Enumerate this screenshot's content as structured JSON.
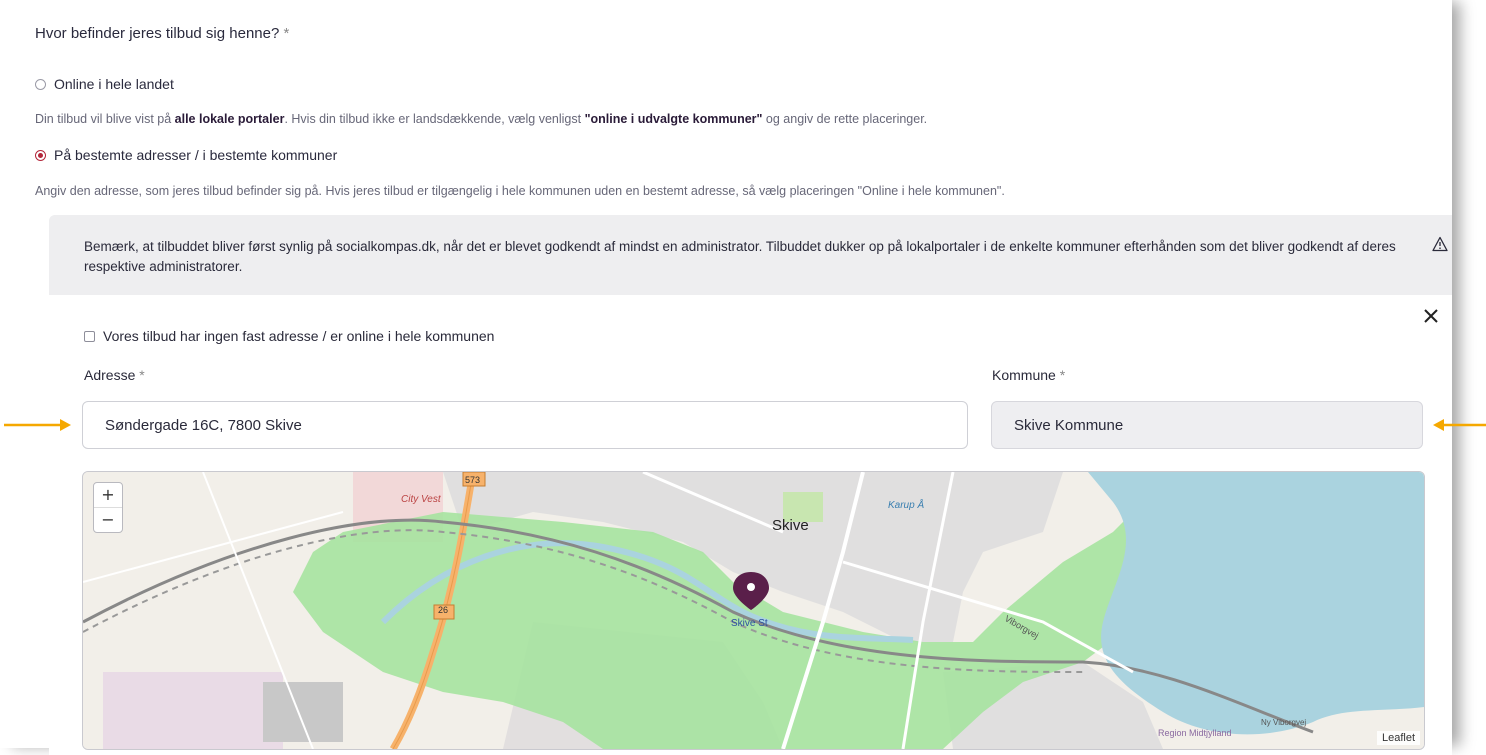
{
  "question": {
    "text": "Hvor befinder jeres tilbud sig henne?",
    "required": "*"
  },
  "options": [
    {
      "label": "Online i hele landet",
      "checked": false,
      "help_parts": [
        "Din tilbud vil blive vist på ",
        "alle lokale portaler",
        ". Hvis din tilbud ikke er landsdækkende, vælg venligst ",
        "\"online i udvalgte kommuner\"",
        " og angiv de rette placeringer."
      ]
    },
    {
      "label": "På bestemte adresser / i bestemte kommuner",
      "checked": true,
      "help": "Angiv den adresse, som jeres tilbud befinder sig på. Hvis jeres tilbud er tilgængelig i hele kommunen uden en bestemt adresse, så vælg placeringen \"Online i hele kommunen\"."
    }
  ],
  "notice": "Bemærk, at tilbuddet bliver først synlig på socialkompas.dk, når det er blevet godkendt af mindst en administrator. Tilbuddet dukker op på lokalportaler i de enkelte kommuner efterhånden som det bliver godkendt af deres respektive administratorer.",
  "location": {
    "no_address_checkbox": "Vores tilbud har ingen fast adresse / er online i hele kommunen",
    "address_label": "Adresse",
    "address_value": "Søndergade 16C, 7800 Skive",
    "municipality_label": "Kommune",
    "municipality_value": "Skive Kommune",
    "required": "*"
  },
  "map": {
    "zoom_in": "+",
    "zoom_out": "−",
    "attribution": "Leaflet",
    "labels": {
      "city": "Skive",
      "city_vest": "City Vest",
      "station": "Skive St",
      "road_573": "573",
      "road_26": "26",
      "karup": "Karup Å",
      "region": "Region Midtjylland",
      "viborgvej": "Viborgvej",
      "ny_viborgvej": "Ny Viborgvej"
    }
  },
  "colors": {
    "accent": "#b3263a",
    "marker": "#5a1f4a",
    "water": "#aad3df",
    "park": "#a6e3a0",
    "arrow": "#f5a800"
  }
}
